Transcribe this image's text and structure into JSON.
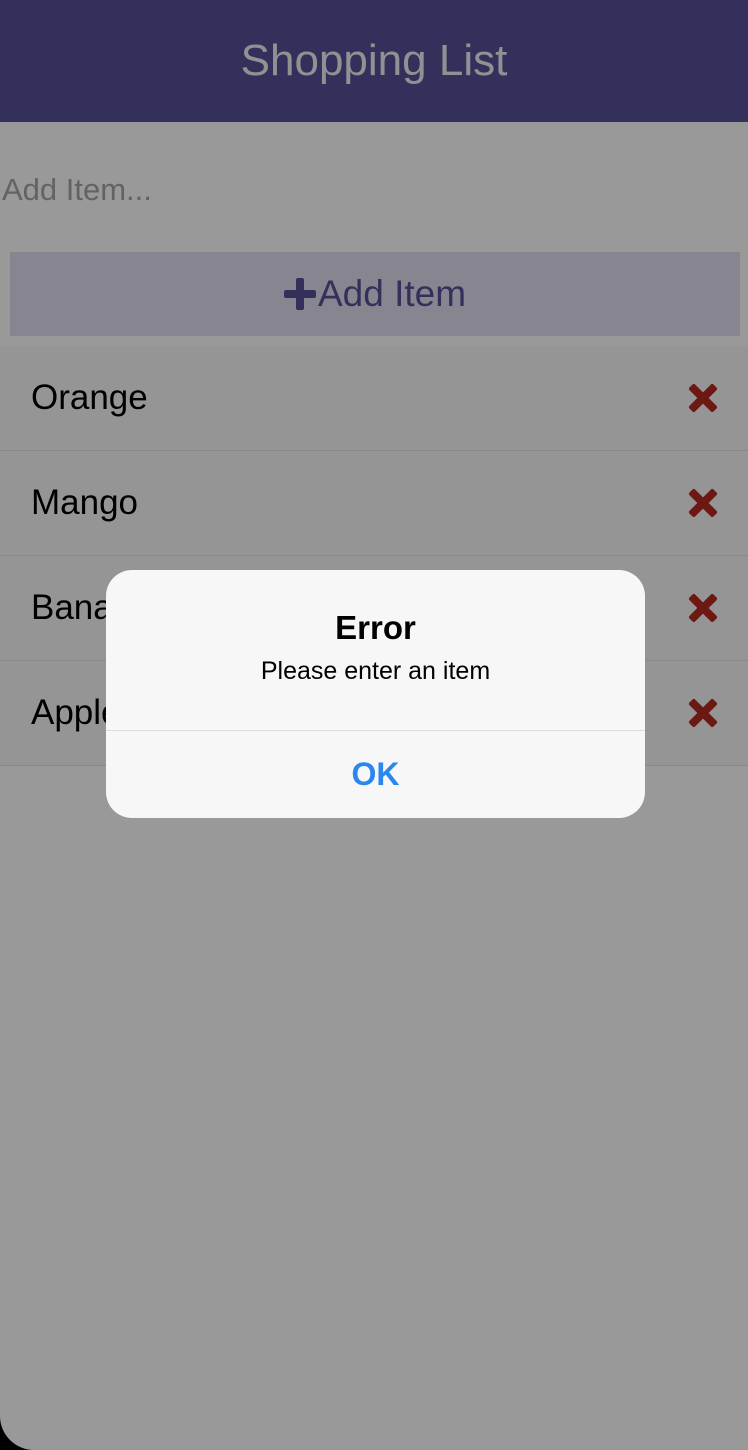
{
  "header": {
    "title": "Shopping List"
  },
  "add_item_input": {
    "value": "",
    "placeholder": "Add Item..."
  },
  "add_item_button": {
    "icon": "plus-icon",
    "label": "Add Item"
  },
  "items": [
    {
      "label": "Orange",
      "delete_icon": "close-icon"
    },
    {
      "label": "Mango",
      "delete_icon": "close-icon"
    },
    {
      "label": "Banana",
      "delete_icon": "close-icon"
    },
    {
      "label": "Apple",
      "delete_icon": "close-icon"
    }
  ],
  "alert": {
    "title": "Error",
    "message": "Please enter an item",
    "ok_label": "OK"
  },
  "colors": {
    "header_background": "#57509a",
    "accent": "#57509a",
    "add_button_background": "#e2deef",
    "delete_icon": "#b52820",
    "alert_ok": "#2b86f0"
  }
}
